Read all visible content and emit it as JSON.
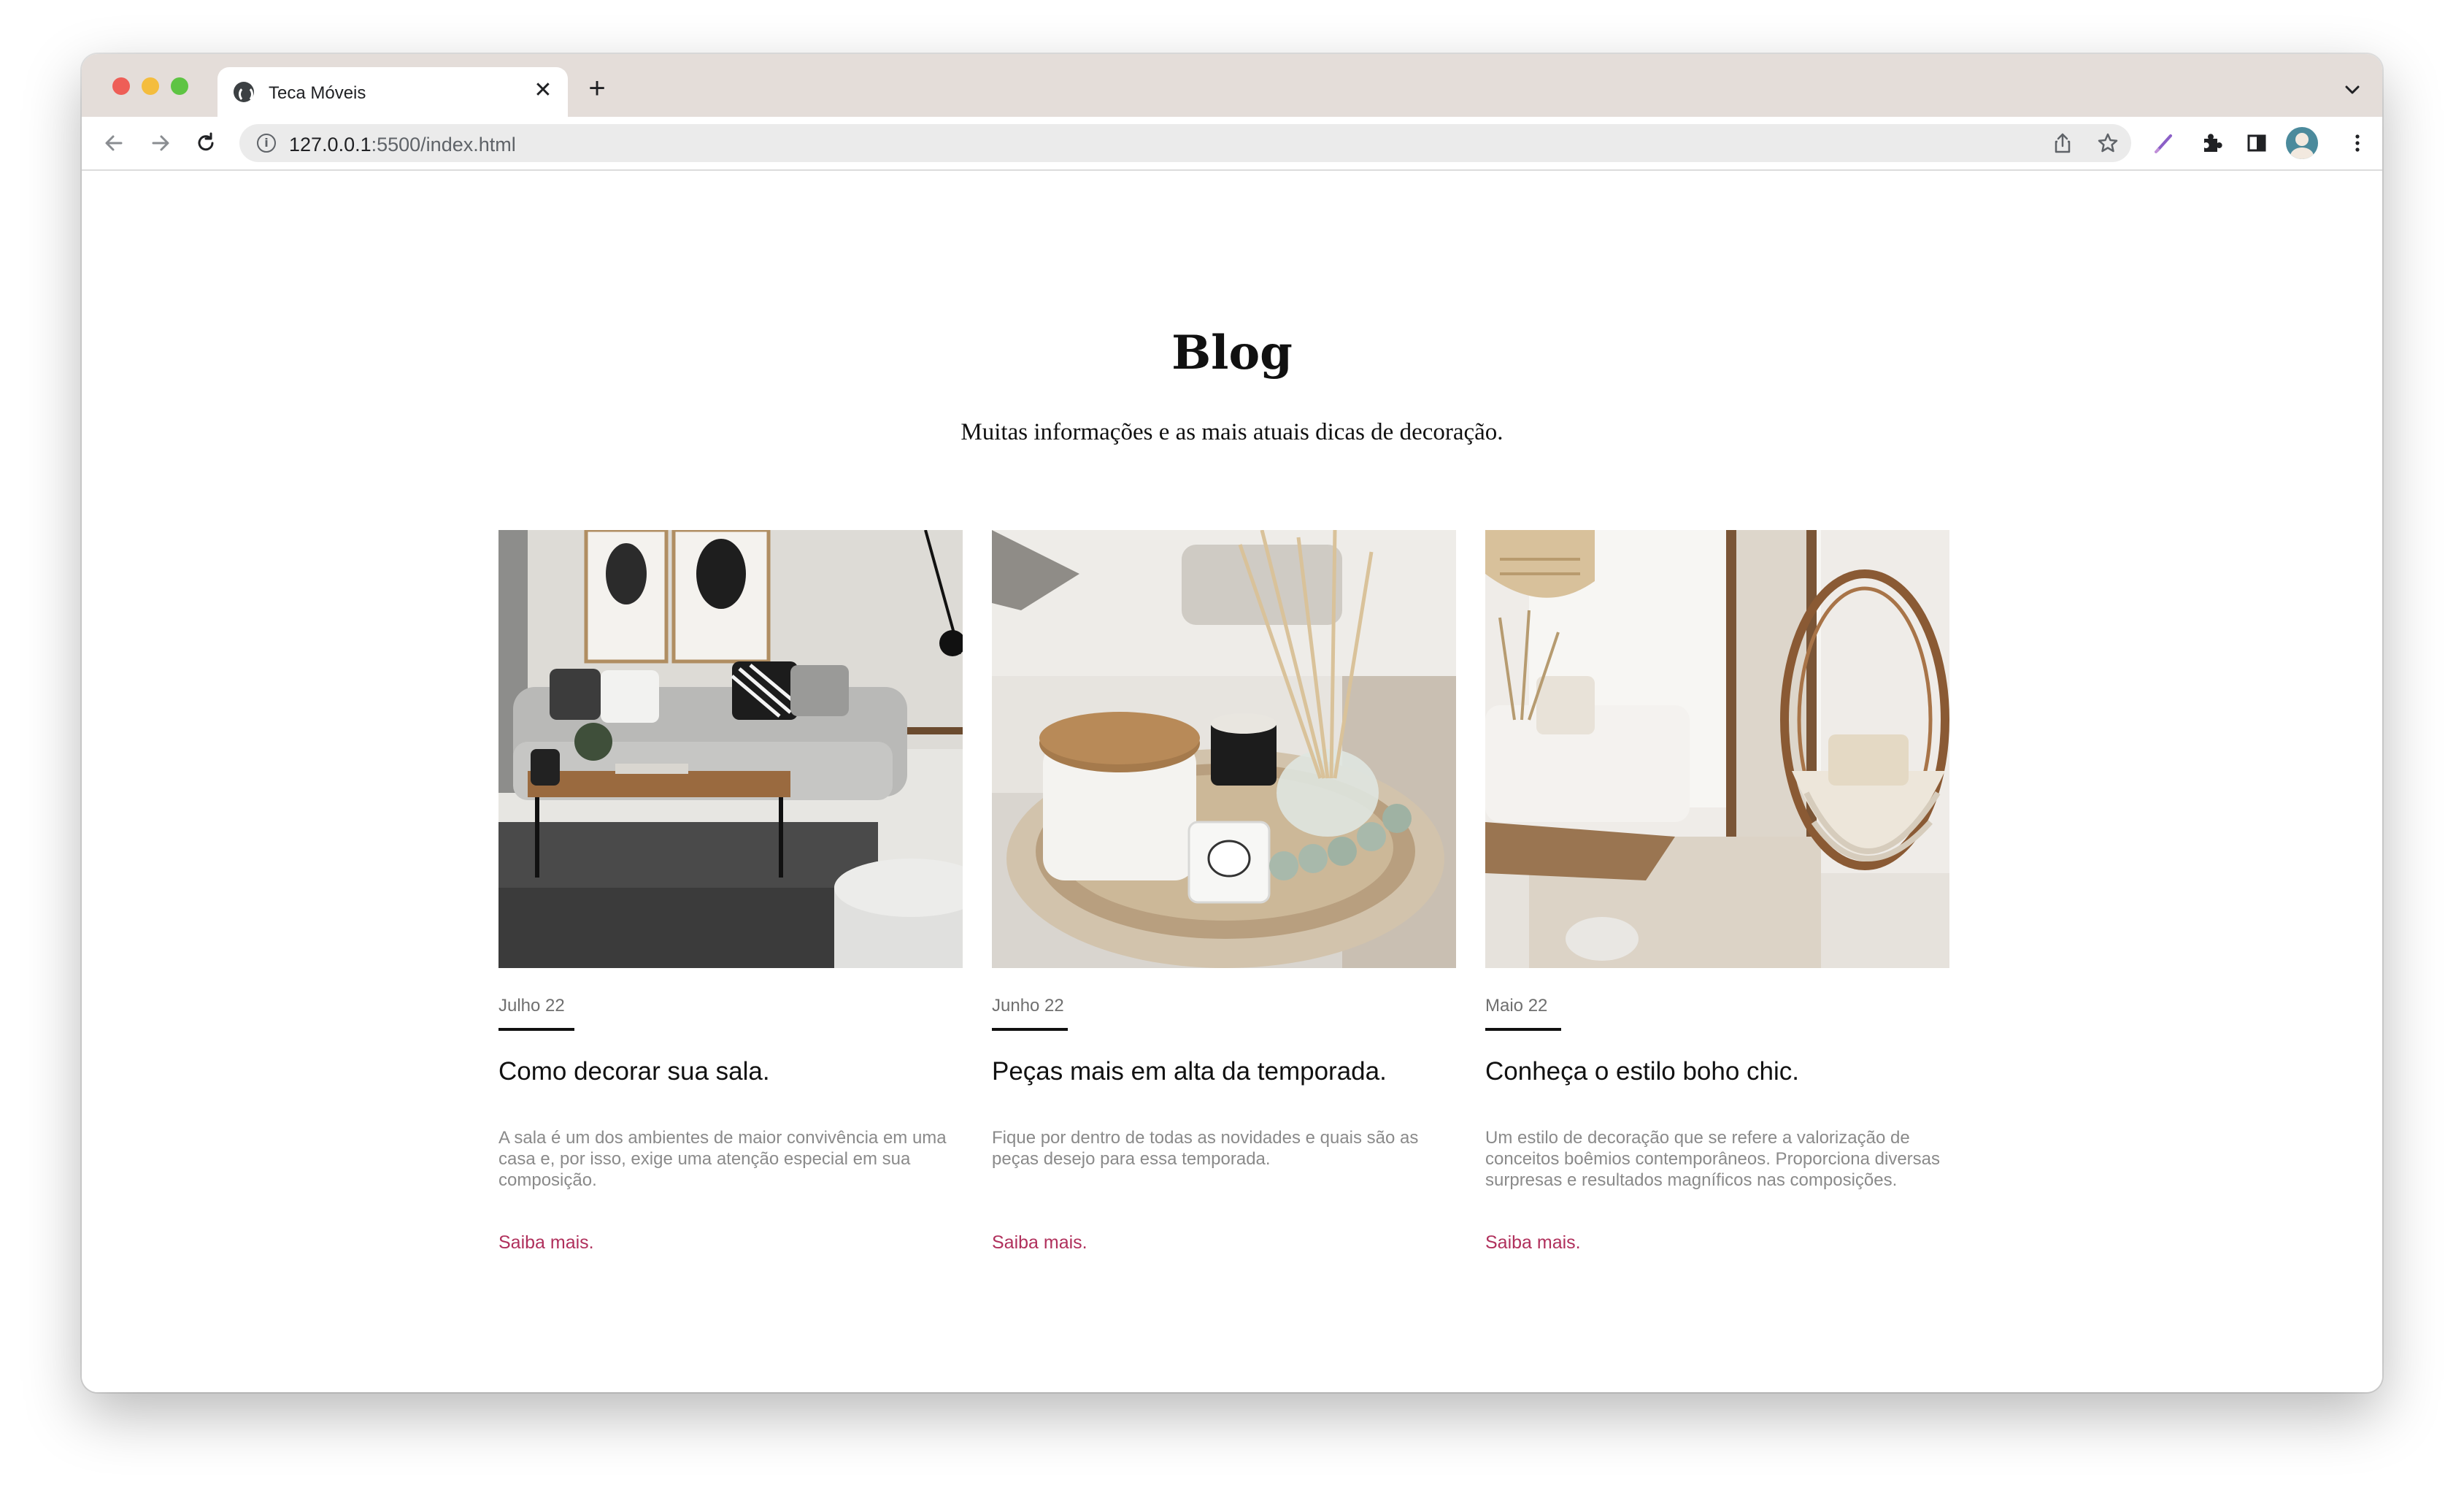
{
  "browser": {
    "tab_title": "Teca Móveis",
    "tab_close": "✕",
    "new_tab": "+",
    "url_host": "127.0.0.1",
    "url_rest": ":5500/index.html"
  },
  "page": {
    "title": "Blog",
    "subtitle": "Muitas informações e as mais atuais dicas de decoração."
  },
  "posts": [
    {
      "date": "Julho 22",
      "title": "Como decorar sua sala.",
      "excerpt": "A sala é um dos ambientes de maior convivência em uma casa e, por isso, exige uma atenção especial em sua composição.",
      "link": "Saiba mais.",
      "image": "living-room-photo"
    },
    {
      "date": "Junho 22",
      "title": "Peças mais em alta da temporada.",
      "excerpt": "Fique por dentro de todas as novidades e quais são as peças desejo para essa temporada.",
      "link": "Saiba mais.",
      "image": "candles-diffuser-photo"
    },
    {
      "date": "Maio 22",
      "title": "Conheça o estilo boho chic.",
      "excerpt": "Um estilo de decoração que se refere a valorização de conceitos boêmios contemporâneos. Proporciona diversas surpresas e resultados magníficos nas composições.",
      "link": "Saiba mais.",
      "image": "boho-room-photo"
    }
  ],
  "colors": {
    "tab_strip": "#e4ddd9",
    "link": "#b0305c",
    "footer": "#121212"
  }
}
